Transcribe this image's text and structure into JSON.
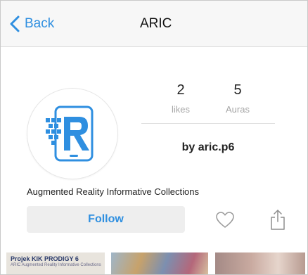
{
  "navbar": {
    "back_label": "Back",
    "title": "ARIC"
  },
  "profile": {
    "stats": [
      {
        "value": "2",
        "label": "likes"
      },
      {
        "value": "5",
        "label": "Auras"
      }
    ],
    "byline": "by aric.p6",
    "description": "Augmented Reality Informative Collections",
    "follow_label": "Follow"
  },
  "thumbnails": [
    {
      "title": "Projek KIK PRODIGY 6",
      "subtitle": "ARIC Augmented Reality Informative Collections"
    },
    {},
    {}
  ],
  "colors": {
    "accent": "#2f8fe0",
    "button_bg": "#eeeeee",
    "muted_text": "#a6a6a6"
  },
  "icons": {
    "back": "chevron-left-icon",
    "avatar": "aric-logo",
    "like": "heart-outline-icon",
    "share": "share-icon"
  }
}
